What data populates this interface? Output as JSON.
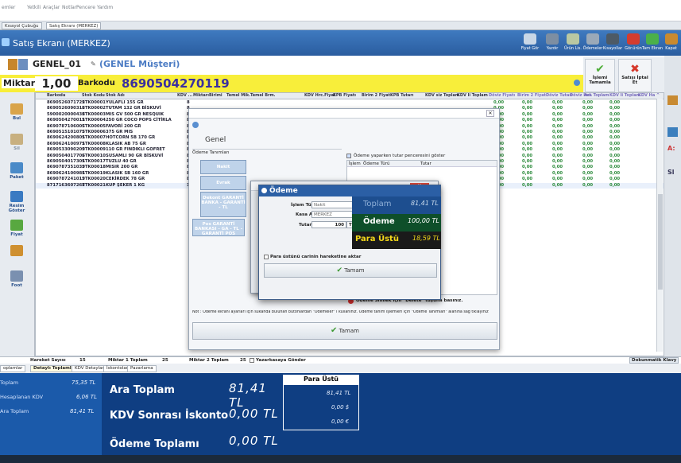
{
  "menu": {
    "items": [
      "emler",
      "Yetkili",
      "Araçlar",
      "Notlar",
      "Pencere",
      "Yardım"
    ]
  },
  "tabs": [
    "Kısayol Çubuğu",
    "Satış Ekranı (MERKEZ)"
  ],
  "title": "Satış Ekranı (MERKEZ)",
  "toolbar": {
    "buttons": [
      "Fiyat Gör",
      "Yazdır",
      "Ürün Lis.",
      "Ödemeler",
      "Kısayollar",
      "Gör.ürün",
      "Tam Ekran",
      "Kapat"
    ]
  },
  "customer": {
    "code": "GENEL_01",
    "name": "(GENEL Müşteri)"
  },
  "actions": {
    "complete": "İşlemi Tamamla",
    "cancel": "Satışı İptal Et"
  },
  "entry": {
    "miktar_label": "Miktarı",
    "miktar_value": "1,00",
    "barkod_label": "Barkodu",
    "barkod_value": "8690504270119"
  },
  "leftbar": [
    "Bul",
    "Sil",
    "Paket",
    "Resim Göster",
    "Fiyat",
    "",
    "Foot"
  ],
  "grid": {
    "columns": [
      "Barkodu",
      "Stok Kodu",
      "Stok Adı",
      "KDV ...",
      "Miktarı",
      "Birimi",
      "Temel Mik.",
      "Temel Brm.",
      "KDV Hrc.Fiyat",
      "KPB Fiyatı",
      "Birim 2 Fiyatı",
      "KPB Tutarı",
      "KDV siz Toplam",
      "KDV li Toplam",
      "Döviz Fiyatı",
      "Birim 2 Fiyatı",
      "Döviz Tutarı",
      "Döviz İnd.",
      "Ara Toplam",
      "KDV li Toplam",
      "KDV Ha ^"
    ],
    "rows": [
      {
        "barcode": "8690526071722",
        "code": "STK00001",
        "name": "YULAFLI 155 GR",
        "kdv": "8"
      },
      {
        "barcode": "8690526090316",
        "code": "STK00002",
        "name": "TUTAM 132 GR BİSKUVİ",
        "kdv": "8"
      },
      {
        "barcode": "5900020000438",
        "code": "STK00003",
        "name": "MIS GV 500 GR NESQUIK",
        "kdv": "8"
      },
      {
        "barcode": "8690504270011",
        "code": "STK00004",
        "name": "250 GR COCO POPS CİTİRLA",
        "kdv": "8"
      },
      {
        "barcode": "8690787106005",
        "code": "STK00005",
        "name": "FAVORİ 200 GR",
        "kdv": "8"
      },
      {
        "barcode": "8690515101075",
        "code": "STK00006",
        "name": "375 GR MIS",
        "kdv": "8"
      },
      {
        "barcode": "8690624200801",
        "code": "STK00007",
        "name": "HOTCORN 5B 170 GR",
        "kdv": "8"
      },
      {
        "barcode": "8690624100971",
        "code": "STK00008",
        "name": "KLASIK AB 75 GR",
        "kdv": "8"
      },
      {
        "barcode": "8690533090209",
        "code": "STK00009",
        "name": "110 GR FINDIKLI GOFRET",
        "kdv": "8"
      },
      {
        "barcode": "8690504017706",
        "code": "STK00010",
        "name": "SUSAMLI 90 GR BİSKUVİ",
        "kdv": "8"
      },
      {
        "barcode": "8690504017301",
        "code": "STK00017",
        "name": "TUZLU 40 GR",
        "kdv": "8"
      },
      {
        "barcode": "8690787351039",
        "code": "STK00018",
        "name": "MISIR 200 GR",
        "kdv": "8"
      },
      {
        "barcode": "8690624100981",
        "code": "STK00019",
        "name": "KLASIK SB 160 GR",
        "kdv": "8"
      },
      {
        "barcode": "8690787241019",
        "code": "STK00020",
        "name": "CEKİRDEK 78 GR",
        "kdv": "8"
      },
      {
        "barcode": "8717163607267",
        "code": "STK00021",
        "name": "KUP ŞEKER 1 KG",
        "kdv": "18"
      }
    ],
    "zero": "0,00"
  },
  "status": {
    "hareket_label": "Hareket Sayısı",
    "hareket_value": "15",
    "miktar1_label": "Miktar 1 Toplam",
    "miktar1_value": "25",
    "miktar2_label": "Miktar 2 Toplam",
    "miktar2_value": "25",
    "yazarkasa": "Yazarkasaya Gönder",
    "dokunmatik": "Dokunmatik Klavy"
  },
  "bottom_tabs": [
    "oplamlar",
    "Detaylı Toplamlar",
    "KDV Detayları",
    "İskontolar",
    "Pazarlama"
  ],
  "summary": {
    "left": [
      {
        "label": "Toplam",
        "value": "75,35 TL"
      },
      {
        "label": "Hesaplanan KDV",
        "value": "6,06 TL"
      },
      {
        "label": "Ara Toplam",
        "value": "81,41 TL"
      }
    ],
    "ara_toplam_label": "Ara Toplam",
    "ara_toplam_value": "81,41 TL",
    "kdv_label": "KDV Sonrası İskonto",
    "kdv_value": "0,00 TL",
    "odeme_label": "Ödeme Toplamı",
    "odeme_value": "0,00 TL",
    "para_ustu_label": "Para Üstü",
    "para_ustu_values": [
      "81,41 TL",
      "0,00 $",
      "0,00 €"
    ]
  },
  "dlg1": {
    "title": "Genel",
    "odeme_label": "Ödeme Tanımları",
    "btn_nakit": "Nakit",
    "btn_evrak": "Evrak",
    "btn_dekont": "Dekont GARANTİ BANKA - GARANTİ - TL",
    "btn_pos": "Pos GARANTİ BANKASI - GA - TL - GARANTİ POS",
    "checkbox": "Ödeme yaparken tutar penceresini göster",
    "col_islem": "İşlem",
    "col_odeme": "Ödeme Türü",
    "col_tutar": "Tutar",
    "delete_hint": "Ödeme Silmek için \"Delete\" tuşuna basınız.",
    "note": "Not : Ödeme ekranı ayarları için sukanda bulunan butonlardan \"Ödemeler\" i kullanınız. Ödeme tanım işlemleri için \"Ödeme Tanımları\" alanına sağ tıklayınız",
    "ok": "Tamam"
  },
  "dlg3": {
    "title": "Ödeme",
    "islem_label": "İşlem Türü",
    "islem_value": "Nakit",
    "kasa_label": "Kasa Adı",
    "kasa_value": "MERKEZ",
    "tutar_label": "Tutar",
    "tutar_value": "100",
    "tutar_unit": "TL",
    "checkbox": "Para üstünü carinin hareketine aktar",
    "ok": "Tamam",
    "toplam_label": "Toplam",
    "toplam_value": "81,41 TL",
    "odeme_label": "Ödeme",
    "odeme_value": "100,00 TL",
    "para_label": "Para Üstü",
    "para_value": "18,59 TL"
  },
  "colors": {
    "title_blue": "#2f67ae",
    "barcode_yellow": "#f8ee3a",
    "summary_blue": "#0f3e82",
    "odeme_green": "#0e4f2a"
  }
}
